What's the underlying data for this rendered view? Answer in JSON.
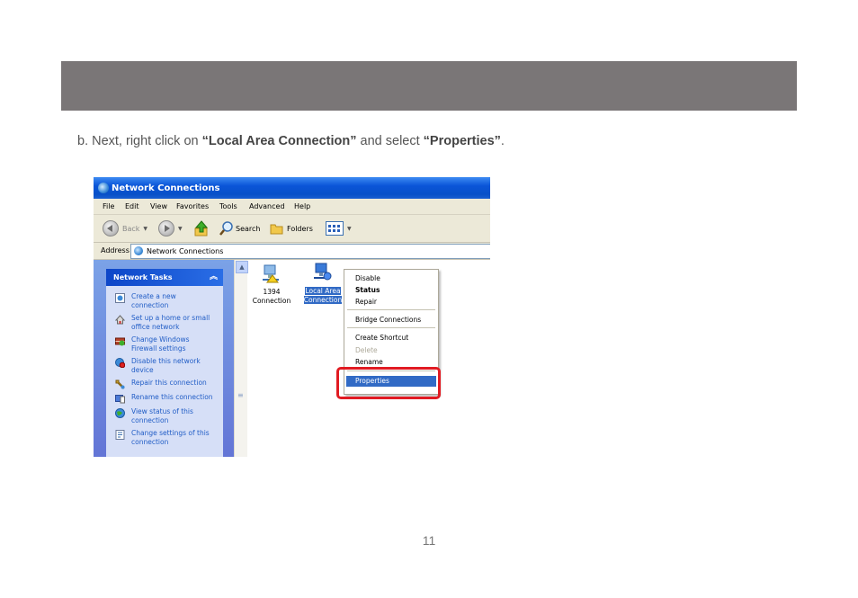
{
  "instruction": {
    "prefix": "b. Next, right click on ",
    "target": "“Local Area Connection”",
    "middle": " and select ",
    "action": "“Properties”",
    "suffix": "."
  },
  "page_number": "11",
  "window": {
    "title": "Network Connections",
    "menu": [
      "File",
      "Edit",
      "View",
      "Favorites",
      "Tools",
      "Advanced",
      "Help"
    ],
    "toolbar": {
      "back": "Back",
      "search": "Search",
      "folders": "Folders"
    },
    "address": {
      "label": "Address",
      "value": "Network Connections"
    },
    "network_tasks": {
      "header": "Network Tasks",
      "items": [
        {
          "line1": "Create a new",
          "line2": "connection"
        },
        {
          "line1": "Set up a home or small",
          "line2": "office network"
        },
        {
          "line1": "Change Windows",
          "line2": "Firewall settings"
        },
        {
          "line1": "Disable this network",
          "line2": "device"
        },
        {
          "line1": "Repair this connection",
          "line2": ""
        },
        {
          "line1": "Rename this connection",
          "line2": ""
        },
        {
          "line1": "View status of this",
          "line2": "connection"
        },
        {
          "line1": "Change settings of this",
          "line2": "connection"
        }
      ]
    },
    "connections": [
      {
        "line1": "1394",
        "line2": "Connection"
      },
      {
        "line1": "Local Area",
        "line2": "Connection"
      }
    ],
    "context_menu": {
      "disable": "Disable",
      "status": "Status",
      "repair": "Repair",
      "bridge": "Bridge Connections",
      "shortcut": "Create Shortcut",
      "delete": "Delete",
      "rename": "Rename",
      "properties": "Properties"
    },
    "colors": {
      "highlight": "#316ac5",
      "callout": "#e11b22",
      "banner": "#7a7677"
    }
  }
}
